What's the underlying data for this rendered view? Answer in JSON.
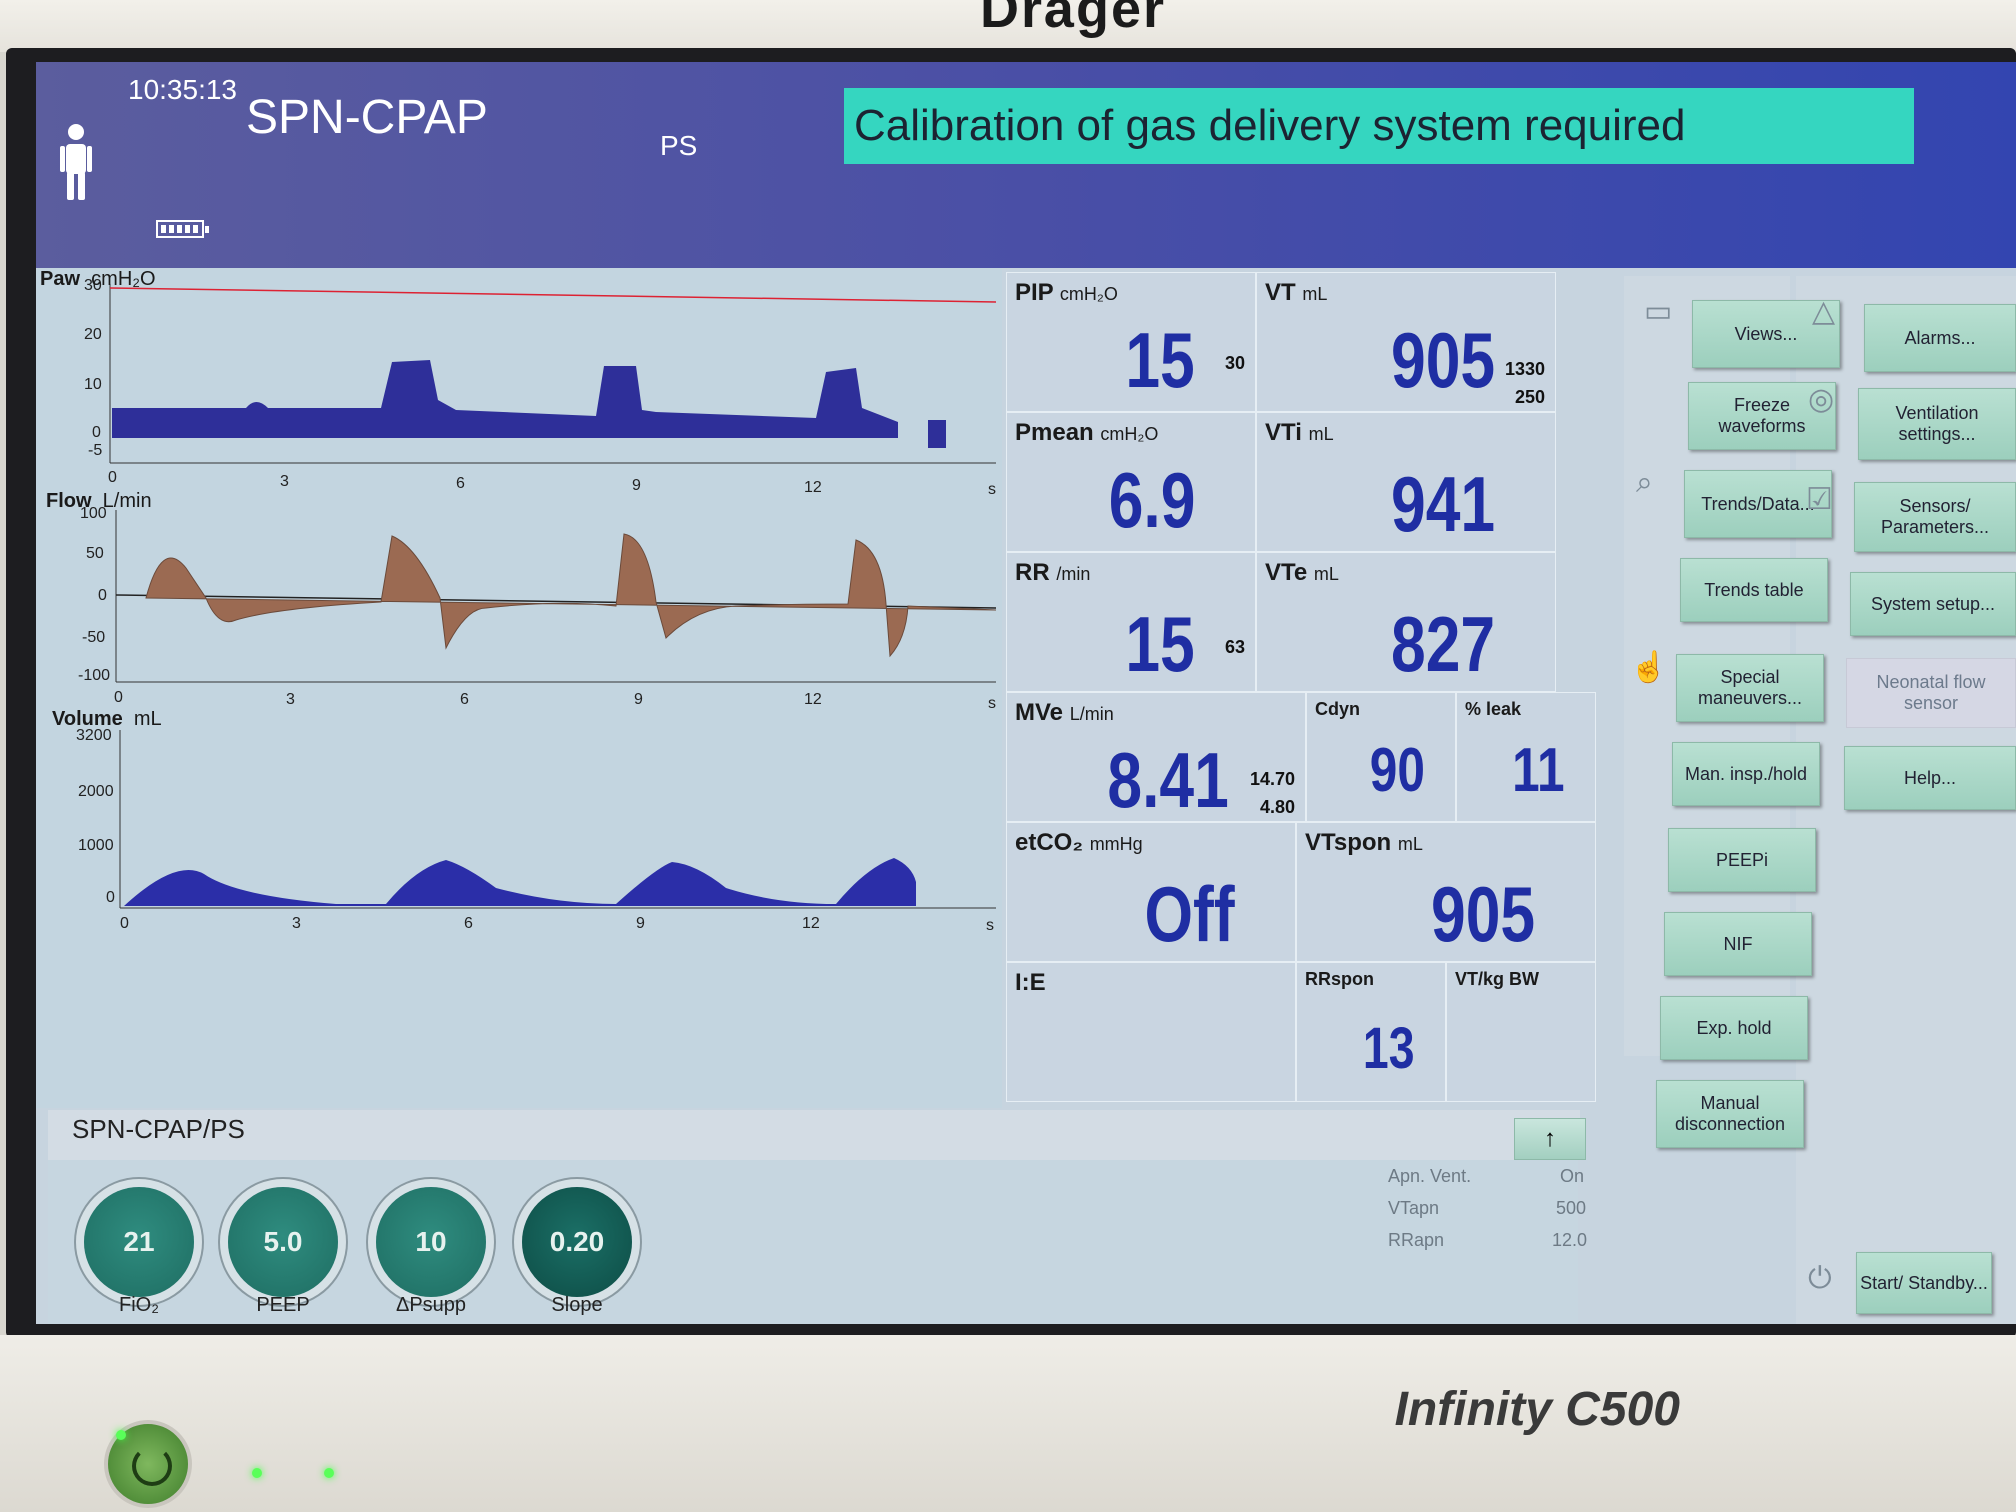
{
  "device": {
    "brand": "Dräger",
    "model": "Infinity C500"
  },
  "header": {
    "time": "10:35:13",
    "mode": "SPN-CPAP",
    "submode": "PS",
    "alarm_message": "Calibration of gas delivery system required"
  },
  "waveforms": {
    "paw": {
      "title": "Paw",
      "unit": "cmH₂O",
      "y_ticks": [
        "30",
        "20",
        "10",
        "0",
        "-5"
      ],
      "x_ticks": [
        "0",
        "3",
        "6",
        "9",
        "12",
        "s"
      ],
      "color": "#2e2f99"
    },
    "flow": {
      "title": "Flow",
      "unit": "L/min",
      "y_ticks": [
        "100",
        "50",
        "0",
        "-50",
        "-100"
      ],
      "x_ticks": [
        "0",
        "3",
        "6",
        "9",
        "12",
        "s"
      ],
      "color": "#9b6a52"
    },
    "volume": {
      "title": "Volume",
      "unit": "mL",
      "y_ticks": [
        "3200",
        "2000",
        "1000",
        "0"
      ],
      "x_ticks": [
        "0",
        "3",
        "6",
        "9",
        "12",
        "s"
      ],
      "color": "#2b2ea8"
    }
  },
  "params": {
    "pip": {
      "label": "PIP",
      "unit": "cmH₂O",
      "value": "15",
      "limit": "30"
    },
    "vt": {
      "label": "VT",
      "unit": "mL",
      "value": "905",
      "limit_high": "1330",
      "limit_low": "250"
    },
    "pmean": {
      "label": "Pmean",
      "unit": "cmH₂O",
      "value": "6.9"
    },
    "vti": {
      "label": "VTi",
      "unit": "mL",
      "value": "941"
    },
    "rr": {
      "label": "RR",
      "unit": "/min",
      "value": "15",
      "limit": "63"
    },
    "vte": {
      "label": "VTe",
      "unit": "mL",
      "value": "827"
    },
    "mve": {
      "label": "MVe",
      "unit": "L/min",
      "value": "8.41",
      "limit_high": "14.70",
      "limit_low": "4.80"
    },
    "cdyn": {
      "label": "Cdyn",
      "value": "90"
    },
    "leak": {
      "label": "% leak",
      "value": "11"
    },
    "etco2": {
      "label": "etCO₂",
      "unit": "mmHg",
      "value": "Off"
    },
    "vtspon": {
      "label": "VTspon",
      "unit": "mL",
      "value": "905"
    },
    "ie": {
      "label": "I:E"
    },
    "rrspon": {
      "label": "RRspon",
      "value": "13"
    },
    "vtkg": {
      "label": "VT/kg BW"
    }
  },
  "menu": {
    "views": "Views...",
    "freeze": "Freeze waveforms",
    "trends_data": "Trends/Data...",
    "trends_table": "Trends table",
    "special": "Special maneuvers...",
    "man_insp": "Man. insp./hold",
    "peepi": "PEEPi",
    "nif": "NIF",
    "exp_hold": "Exp. hold",
    "manual_disc": "Manual disconnection",
    "alarms": "Alarms...",
    "vent_settings": "Ventilation settings...",
    "sensors": "Sensors/ Parameters...",
    "system_setup": "System setup...",
    "neonatal": "Neonatal flow sensor",
    "help": "Help...",
    "standby": "Start/ Standby..."
  },
  "settings": {
    "mode": "SPN-CPAP/PS",
    "arrow": "↑",
    "knobs": [
      {
        "label": "FiO₂",
        "value": "21"
      },
      {
        "label": "PEEP",
        "value": "5.0"
      },
      {
        "label": "ΔPsupp",
        "value": "10"
      },
      {
        "label": "Slope",
        "value": "0.20"
      }
    ],
    "apnea": [
      {
        "label": "Apn. Vent.",
        "value": "On"
      },
      {
        "label": "VTapn",
        "value": "500"
      },
      {
        "label": "RRapn",
        "value": "12.0"
      }
    ]
  }
}
